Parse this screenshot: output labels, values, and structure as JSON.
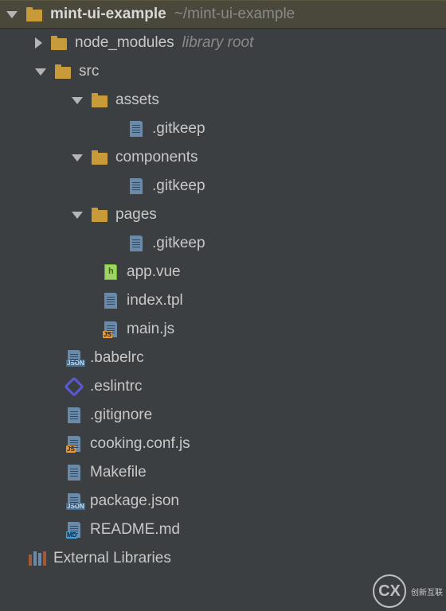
{
  "root": {
    "name": "mint-ui-example",
    "path": "~/mint-ui-example"
  },
  "nodes": {
    "node_modules": "node_modules",
    "library_root": "library root",
    "src": "src",
    "assets": "assets",
    "components": "components",
    "pages": "pages",
    "gitkeep": ".gitkeep",
    "app_vue": "app.vue",
    "index_tpl": "index.tpl",
    "main_js": "main.js",
    "babelrc": ".babelrc",
    "eslintrc": ".eslintrc",
    "gitignore": ".gitignore",
    "cooking": "cooking.conf.js",
    "makefile": "Makefile",
    "package": "package.json",
    "readme": "README.md",
    "external": "External Libraries"
  },
  "watermark": {
    "logo": "CX",
    "text": "创新互联"
  }
}
